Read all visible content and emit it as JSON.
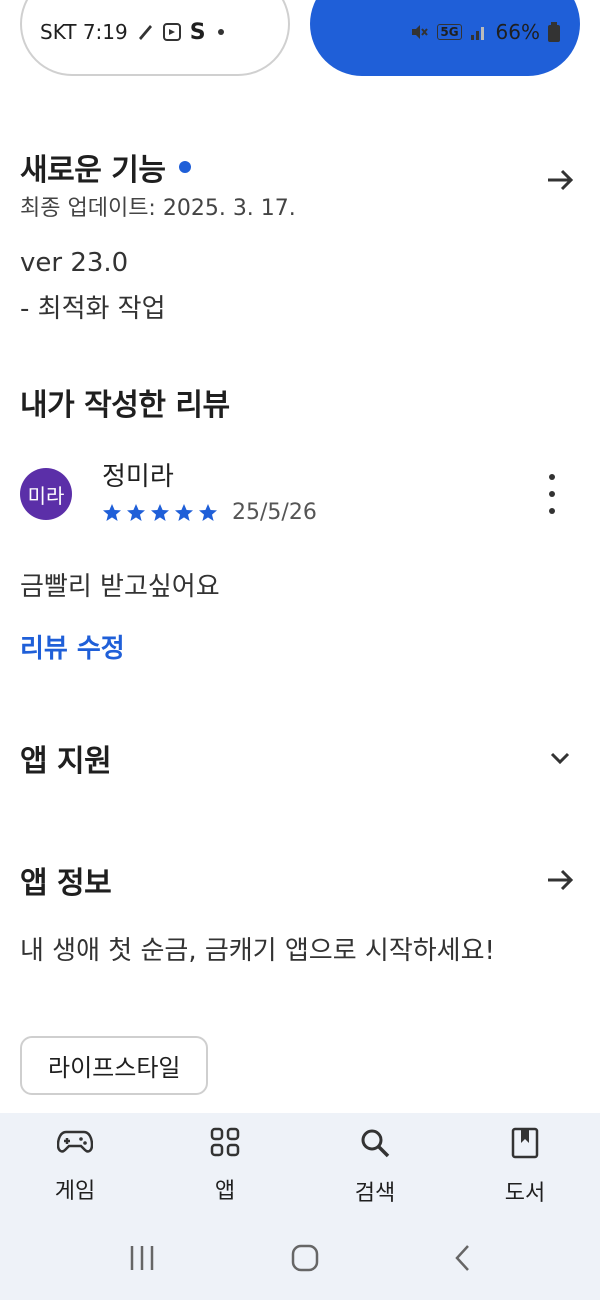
{
  "status": {
    "carrier_time": "SKT 7:19",
    "s_letter": "S",
    "network": "5G",
    "battery": "66%"
  },
  "whats_new": {
    "title": "새로운 기능",
    "last_updated": "최종 업데이트: 2025. 3. 17.",
    "version": "ver 23.0",
    "notes": "- 최적화 작업"
  },
  "my_review": {
    "title": "내가 작성한 리뷰",
    "avatar_text": "미라",
    "reviewer_name": "정미라",
    "rating": 5,
    "date": "25/5/26",
    "text": "금빨리 받고싶어요",
    "edit_label": "리뷰 수정"
  },
  "app_support": {
    "title": "앱 지원"
  },
  "app_info": {
    "title": "앱 정보",
    "description": "내 생애 첫 순금, 금캐기 앱으로 시작하세요!",
    "category_chip": "라이프스타일"
  },
  "bottom_nav": {
    "items": [
      {
        "label": "게임",
        "icon": "gamepad-icon"
      },
      {
        "label": "앱",
        "icon": "apps-grid-icon"
      },
      {
        "label": "검색",
        "icon": "search-icon"
      },
      {
        "label": "도서",
        "icon": "book-icon"
      }
    ]
  },
  "colors": {
    "accent": "#1f5fd8",
    "avatar": "#5b2fa8",
    "nav_bg": "#eef2f8"
  }
}
